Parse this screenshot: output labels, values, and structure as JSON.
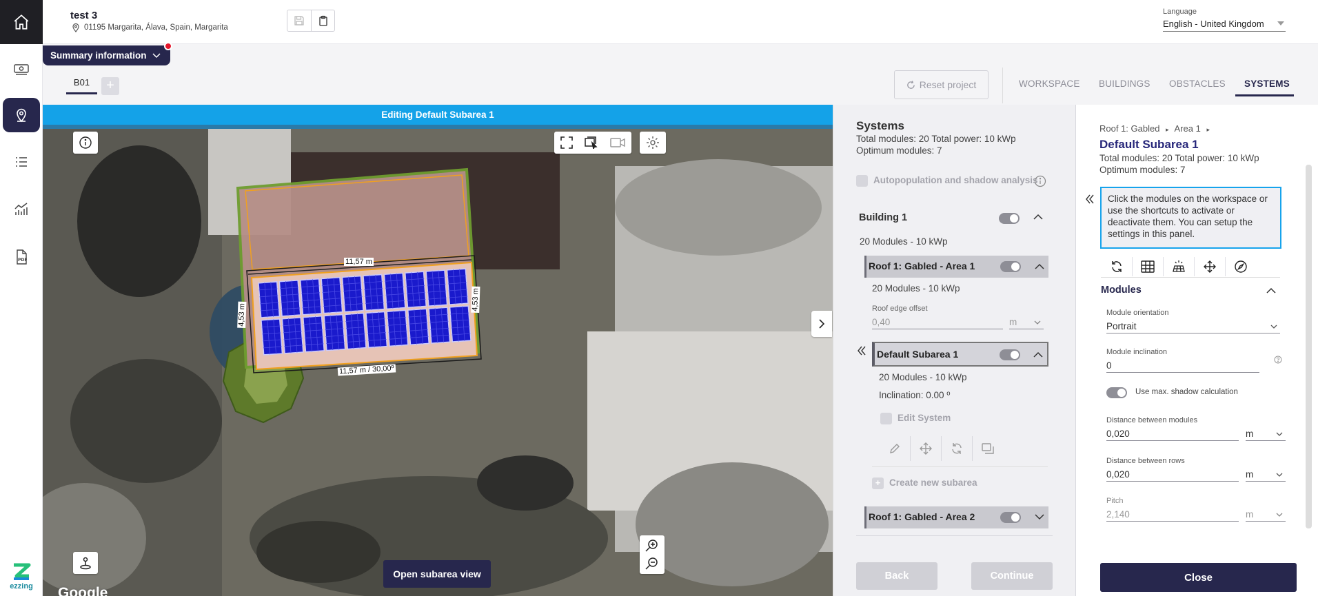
{
  "header": {
    "project_title": "test 3",
    "address": "01195 Margarita, Álava, Spain, Margarita",
    "language_label": "Language",
    "language_value": "English - United Kingdom"
  },
  "summary_tab": {
    "label": "Summary information"
  },
  "building_tabs": [
    {
      "label": "B01"
    }
  ],
  "toolbar": {
    "reset_label": "Reset project",
    "nav": [
      "WORKSPACE",
      "BUILDINGS",
      "OBSTACLES",
      "SYSTEMS"
    ],
    "active_nav": "SYSTEMS"
  },
  "map": {
    "banner": "Editing Default Subarea 1",
    "open_subarea": "Open subarea view",
    "attribution": "Google",
    "measurements": {
      "top": "11,57 m",
      "bottom": "11,57 m / 30,00º",
      "left": "4,53 m",
      "right": "4,53 m"
    },
    "panel_grid": {
      "columns": 10,
      "rows": 2
    }
  },
  "systems": {
    "title": "Systems",
    "totals": "Total modules: 20 Total power: 10 kWp",
    "optimum": "Optimum modules: 7",
    "autopopulation": "Autopopulation and shadow analysis",
    "building": {
      "name": "Building 1",
      "summary": "20 Modules - 10 kWp"
    },
    "roof1": {
      "name": "Roof 1: Gabled - Area 1",
      "summary": "20 Modules - 10 kWp",
      "edge_offset_label": "Roof edge offset",
      "edge_offset_value": "0,40",
      "edge_offset_unit": "m"
    },
    "subarea": {
      "name": "Default Subarea 1",
      "summary": "20 Modules - 10 kWp",
      "inclination": "Inclination: 0.00 º",
      "edit_system": "Edit System"
    },
    "create_subarea": "Create new subarea",
    "roof2": {
      "name": "Roof 1: Gabled - Area 2"
    },
    "back": "Back",
    "continue": "Continue"
  },
  "detail": {
    "breadcrumb": [
      "Roof 1: Gabled",
      "Area 1"
    ],
    "title": "Default Subarea 1",
    "totals": "Total modules: 20 Total power: 10 kWp",
    "optimum": "Optimum modules: 7",
    "info": "Click the modules on the workspace or use the shortcuts to activate or deactivate them. You can setup the settings in this panel.",
    "modules_heading": "Modules",
    "orientation_label": "Module orientation",
    "orientation_value": "Portrait",
    "inclination_label": "Module inclination",
    "inclination_value": "0",
    "shadow_label": "Use max. shadow calculation",
    "dist_modules_label": "Distance between modules",
    "dist_modules_value": "0,020",
    "dist_rows_label": "Distance between rows",
    "dist_rows_value": "0,020",
    "pitch_label": "Pitch",
    "pitch_value": "2,140",
    "unit": "m",
    "close": "Close"
  },
  "brand": {
    "name": "ezzing"
  },
  "colors": {
    "primary": "#27274d",
    "accent": "#14a2e8",
    "alert": "#e4162b",
    "panel": "#1a1acc"
  }
}
